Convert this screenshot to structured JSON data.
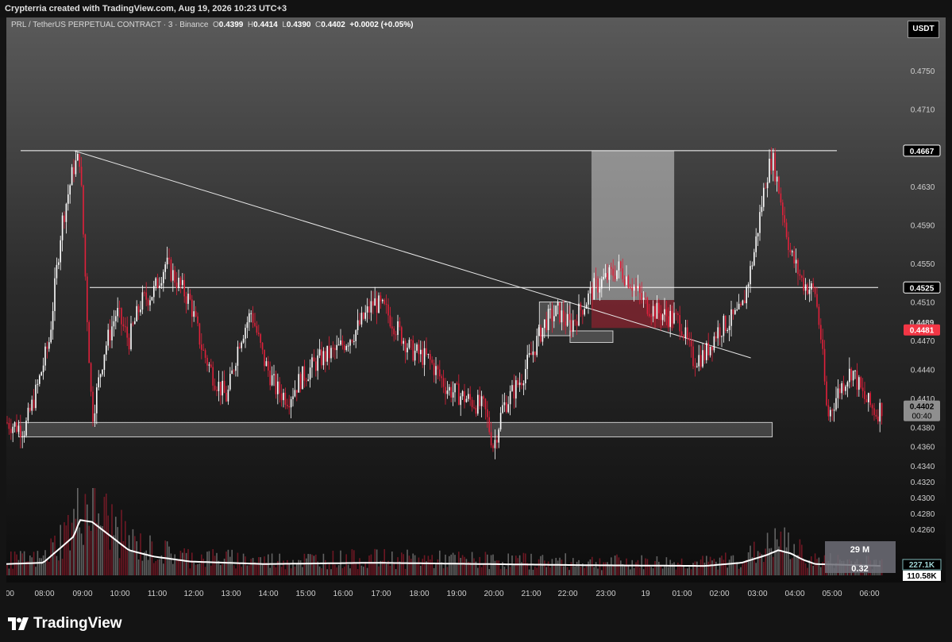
{
  "header": {
    "text": "Crypterria created with TradingView.com, Aug 19, 2026 10:23 UTC+3"
  },
  "legend": {
    "symbol": "PRL / TetherUS PERPETUAL CONTRACT · 3 · Binance",
    "o_label": "O",
    "o_value": "0.4399",
    "h_label": "H",
    "h_value": "0.4414",
    "l_label": "L",
    "l_value": "0.4390",
    "c_label": "C",
    "c_value": "0.4402",
    "change": "+0.0002 (+0.05%)"
  },
  "currency_button": "USDT",
  "brand": {
    "name": "TradingView",
    "icon": "tradingview-logo-icon"
  },
  "colors": {
    "up": "#ffffff",
    "down": "#e0213b",
    "accent_red": "#f23645",
    "level": "#ffffff",
    "zone": "#ffffff",
    "volume_ma": "#ffffff"
  },
  "chart_data": {
    "type": "candlestick",
    "symbol": "PRL/USDT Perpetual",
    "interval": "3",
    "exchange": "Binance",
    "y_ticks": [
      "0.4750",
      "0.4710",
      "0.4630",
      "0.4590",
      "0.4550",
      "0.4510",
      "0.4470",
      "0.4440",
      "0.4410",
      "0.4380",
      "0.4360",
      "0.4340",
      "0.4320",
      "0.4300",
      "0.4280",
      "0.4260"
    ],
    "x_ticks": [
      ":00",
      "08:00",
      "09:00",
      "10:00",
      "11:00",
      "12:00",
      "13:00",
      "14:00",
      "15:00",
      "16:00",
      "17:00",
      "18:00",
      "19:00",
      "20:00",
      "21:00",
      "22:00",
      "23:00",
      "19",
      "01:00",
      "02:00",
      "03:00",
      "04:00",
      "05:00",
      "06:00"
    ],
    "price_labels": [
      {
        "value": "0.4667",
        "style": "level"
      },
      {
        "value": "0.4525",
        "style": "level"
      },
      {
        "value": "0.4489",
        "style": "plain"
      },
      {
        "value": "0.4481",
        "style": "red"
      },
      {
        "value": "0.4402",
        "style": "gray",
        "countdown": "00:40"
      }
    ],
    "volume_labels": [
      {
        "value": "227.1K",
        "style": "outline"
      },
      {
        "value": "110.58K",
        "style": "solid"
      }
    ],
    "measure_tooltip": [
      "29 M",
      "0.32"
    ],
    "horizontal_levels": [
      0.4667,
      0.4525
    ],
    "trendline": {
      "from": {
        "time": "08:50",
        "price": 0.4667
      },
      "to": {
        "time": "03:15",
        "price": 0.4452
      }
    },
    "zones": [
      {
        "kind": "support",
        "from": "07:20",
        "to": "03:50",
        "low": 0.437,
        "high": 0.4385
      },
      {
        "kind": "consolidation",
        "from": "21:30",
        "to": "22:20",
        "low": 0.4475,
        "high": 0.451
      },
      {
        "kind": "consolidation",
        "from": "22:20",
        "to": "23:30",
        "low": 0.4468,
        "high": 0.448
      }
    ],
    "position": {
      "entry": 0.4512,
      "target": 0.4667,
      "stop": 0.4483,
      "from": "22:55",
      "to": "01:10"
    },
    "price_path": [
      [
        "07:00",
        0.4385
      ],
      [
        "07:30",
        0.4378
      ],
      [
        "07:50",
        0.442
      ],
      [
        "08:10",
        0.447
      ],
      [
        "08:30",
        0.459
      ],
      [
        "08:50",
        0.465
      ],
      [
        "09:00",
        0.466
      ],
      [
        "09:10",
        0.452
      ],
      [
        "09:20",
        0.439
      ],
      [
        "09:40",
        0.446
      ],
      [
        "10:00",
        0.45
      ],
      [
        "10:20",
        0.447
      ],
      [
        "10:40",
        0.451
      ],
      [
        "11:00",
        0.452
      ],
      [
        "11:20",
        0.455
      ],
      [
        "11:40",
        0.453
      ],
      [
        "12:00",
        0.451
      ],
      [
        "12:20",
        0.446
      ],
      [
        "12:40",
        0.443
      ],
      [
        "13:00",
        0.441
      ],
      [
        "13:20",
        0.447
      ],
      [
        "13:40",
        0.45
      ],
      [
        "14:00",
        0.445
      ],
      [
        "14:20",
        0.442
      ],
      [
        "14:40",
        0.441
      ],
      [
        "15:00",
        0.443
      ],
      [
        "15:30",
        0.445
      ],
      [
        "16:00",
        0.446
      ],
      [
        "16:30",
        0.448
      ],
      [
        "17:00",
        0.451
      ],
      [
        "17:20",
        0.45
      ],
      [
        "17:40",
        0.448
      ],
      [
        "18:00",
        0.446
      ],
      [
        "18:30",
        0.445
      ],
      [
        "19:00",
        0.442
      ],
      [
        "19:30",
        0.441
      ],
      [
        "20:00",
        0.44
      ],
      [
        "20:15",
        0.436
      ],
      [
        "20:30",
        0.44
      ],
      [
        "21:00",
        0.443
      ],
      [
        "21:20",
        0.446
      ],
      [
        "21:40",
        0.449
      ],
      [
        "22:00",
        0.45
      ],
      [
        "22:20",
        0.4485
      ],
      [
        "22:40",
        0.4505
      ],
      [
        "23:00",
        0.4525
      ],
      [
        "23:20",
        0.4535
      ],
      [
        "23:40",
        0.4545
      ],
      [
        "00:00",
        0.453
      ],
      [
        "00:20",
        0.451
      ],
      [
        "00:40",
        0.45
      ],
      [
        "01:00",
        0.4495
      ],
      [
        "01:20",
        0.449
      ],
      [
        "01:40",
        0.445
      ],
      [
        "02:00",
        0.4455
      ],
      [
        "02:20",
        0.448
      ],
      [
        "02:40",
        0.449
      ],
      [
        "03:00",
        0.45
      ],
      [
        "03:20",
        0.456
      ],
      [
        "03:40",
        0.464
      ],
      [
        "03:50",
        0.466
      ],
      [
        "04:00",
        0.463
      ],
      [
        "04:20",
        0.456
      ],
      [
        "04:40",
        0.453
      ],
      [
        "05:00",
        0.452
      ],
      [
        "05:10",
        0.447
      ],
      [
        "05:20",
        0.439
      ],
      [
        "05:40",
        0.442
      ],
      [
        "06:00",
        0.444
      ],
      [
        "06:20",
        0.441
      ],
      [
        "06:40",
        0.4395
      ],
      [
        "06:50",
        0.4402
      ]
    ],
    "volume_ma_path": [
      [
        "07:00",
        0.18
      ],
      [
        "08:00",
        0.2
      ],
      [
        "08:30",
        0.45
      ],
      [
        "08:50",
        0.62
      ],
      [
        "09:00",
        0.88
      ],
      [
        "09:20",
        0.85
      ],
      [
        "09:40",
        0.7
      ],
      [
        "10:00",
        0.55
      ],
      [
        "10:20",
        0.4
      ],
      [
        "11:00",
        0.3
      ],
      [
        "12:00",
        0.22
      ],
      [
        "14:00",
        0.18
      ],
      [
        "17:00",
        0.2
      ],
      [
        "20:00",
        0.18
      ],
      [
        "23:00",
        0.16
      ],
      [
        "02:00",
        0.15
      ],
      [
        "03:00",
        0.2
      ],
      [
        "03:40",
        0.32
      ],
      [
        "04:00",
        0.4
      ],
      [
        "04:20",
        0.35
      ],
      [
        "04:40",
        0.25
      ],
      [
        "05:00",
        0.18
      ],
      [
        "06:50",
        0.15
      ]
    ]
  }
}
